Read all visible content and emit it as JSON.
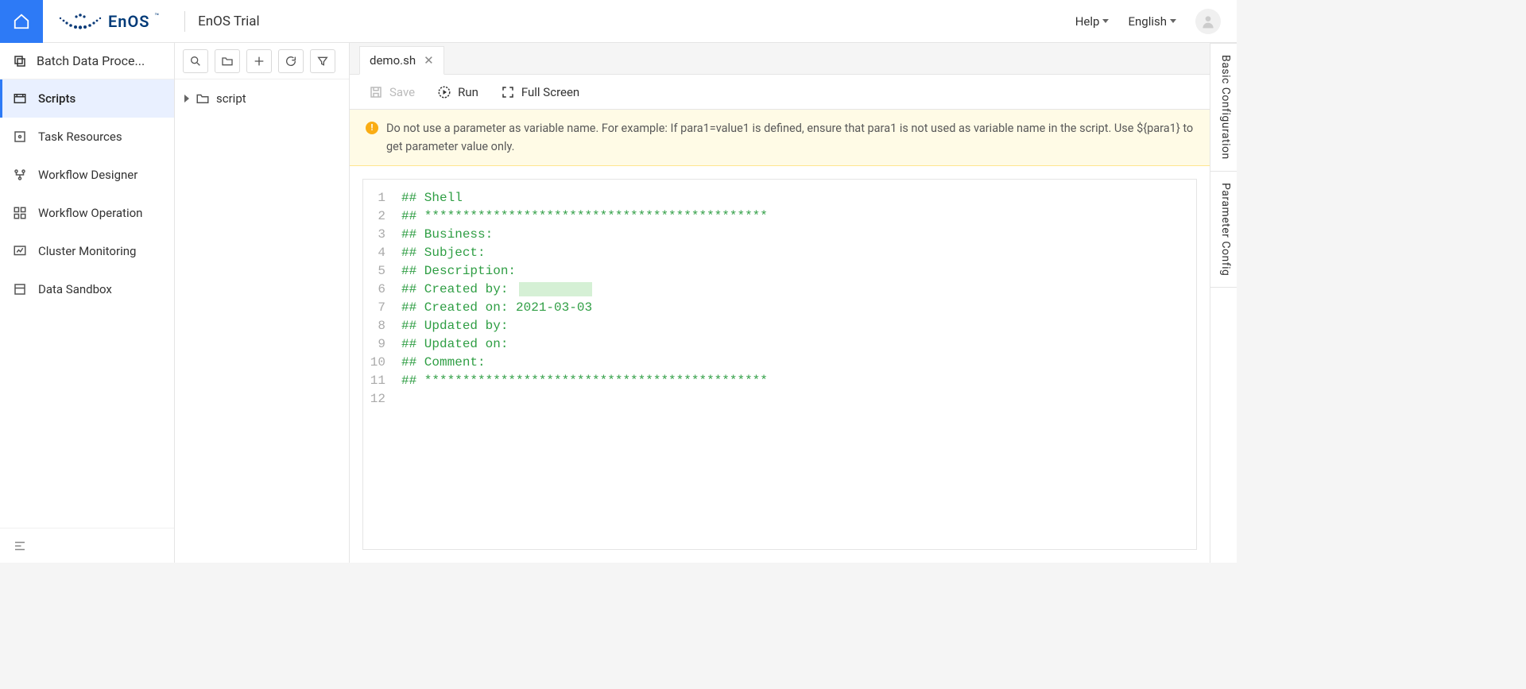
{
  "header": {
    "logo_text": "EnOS",
    "logo_tm": "™",
    "app_title": "EnOS Trial",
    "help_label": "Help",
    "language_label": "English"
  },
  "sidebar": {
    "section_title": "Batch Data Proce...",
    "items": [
      {
        "label": "Scripts",
        "active": true
      },
      {
        "label": "Task Resources",
        "active": false
      },
      {
        "label": "Workflow Designer",
        "active": false
      },
      {
        "label": "Workflow Operation",
        "active": false
      },
      {
        "label": "Cluster Monitoring",
        "active": false
      },
      {
        "label": "Data Sandbox",
        "active": false
      }
    ]
  },
  "explorer": {
    "root_folder": "script"
  },
  "editor": {
    "tab_label": "demo.sh",
    "actions": {
      "save": "Save",
      "run": "Run",
      "fullscreen": "Full Screen"
    },
    "banner_text": "Do not use a parameter as variable name. For example: If para1=value1 is defined, ensure that para1 is not used as variable name in the script. Use ${para1} to get parameter value only.",
    "code_lines": [
      "## Shell",
      "## *********************************************",
      "## Business:",
      "## Subject:",
      "## Description:",
      "## Created by:",
      "## Created on: 2021-03-03",
      "## Updated by:",
      "## Updated on:",
      "## Comment:",
      "## *********************************************",
      ""
    ],
    "created_by_redacted": true
  },
  "right_rail": {
    "tabs": [
      "Basic Configuration",
      "Parameter Config"
    ]
  }
}
